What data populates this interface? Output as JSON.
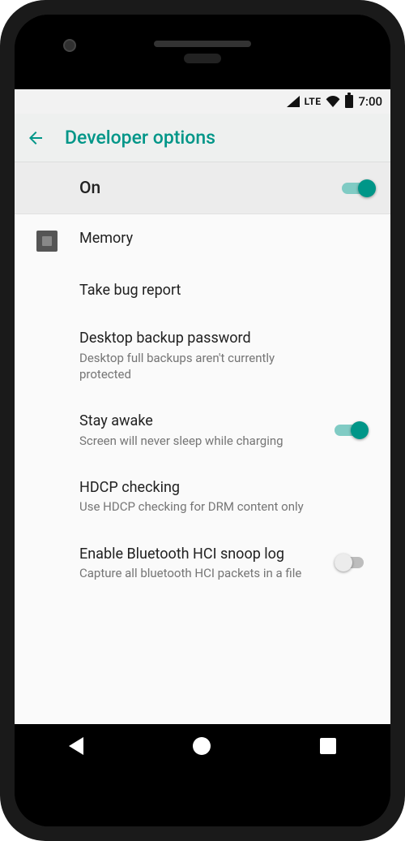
{
  "status": {
    "network": "LTE",
    "time": "7:00"
  },
  "header": {
    "title": "Developer options"
  },
  "master": {
    "label": "On",
    "on": true
  },
  "items": [
    {
      "title": "Memory",
      "subtitle": null,
      "icon": "chip",
      "toggle": null
    },
    {
      "title": "Take bug report",
      "subtitle": null,
      "icon": null,
      "toggle": null
    },
    {
      "title": "Desktop backup password",
      "subtitle": "Desktop full backups aren't currently protected",
      "icon": null,
      "toggle": null
    },
    {
      "title": "Stay awake",
      "subtitle": "Screen will never sleep while charging",
      "icon": null,
      "toggle": true
    },
    {
      "title": "HDCP checking",
      "subtitle": "Use HDCP checking for DRM content only",
      "icon": null,
      "toggle": null
    },
    {
      "title": "Enable Bluetooth HCI snoop log",
      "subtitle": "Capture all bluetooth HCI packets in a file",
      "icon": null,
      "toggle": false
    }
  ]
}
